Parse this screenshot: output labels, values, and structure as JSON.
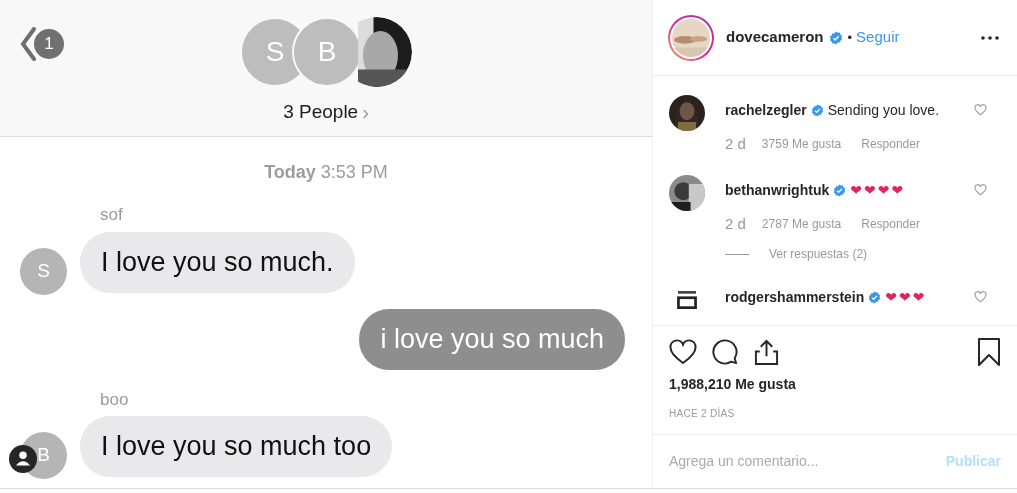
{
  "post_image": {
    "back_count": "1",
    "avatars": [
      {
        "kind": "initial",
        "initial": "S"
      },
      {
        "kind": "initial",
        "initial": "B"
      },
      {
        "kind": "picture"
      }
    ],
    "group_title": "3 People",
    "chevron": "›",
    "timestamp": {
      "day": "Today",
      "time": "3:53 PM"
    },
    "messages": [
      {
        "sender": "sof",
        "avatar": "S",
        "text": "I love you so much.",
        "outgoing": false
      },
      {
        "text": "i love you so much",
        "outgoing": true
      },
      {
        "sender": "boo",
        "avatar": "B",
        "text": "I love you so much too",
        "outgoing": false
      }
    ]
  },
  "header": {
    "username": "dovecameron",
    "verified": true,
    "separator": "•",
    "follow": "Seguir"
  },
  "comments": [
    {
      "username": "rachelzegler",
      "verified": true,
      "text": "Sending you love.",
      "age": "2 d",
      "likes": "3759 Me gusta",
      "reply": "Responder"
    },
    {
      "username": "bethanwrightuk",
      "verified": true,
      "text": "❤❤❤❤",
      "age": "2 d",
      "likes": "2787 Me gusta",
      "reply": "Responder",
      "view_replies": "Ver respuestas (2)"
    },
    {
      "username": "rodgershammerstein",
      "verified": true,
      "text": "❤❤❤"
    }
  ],
  "likes": "1,988,210 Me gusta",
  "date": "HACE 2 DÍAS",
  "comment_field": {
    "placeholder": "Agrega un comentario..."
  },
  "publish": "Publicar"
}
